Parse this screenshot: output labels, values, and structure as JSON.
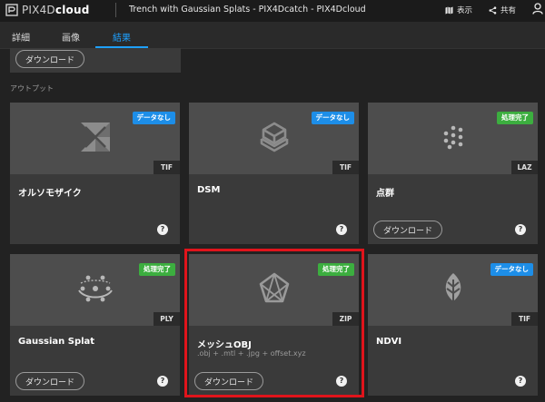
{
  "app": {
    "logo_prefix": "PIX4D",
    "logo_suffix": "cloud",
    "project_title": "Trench with Gaussian Splats - PIX4Dcatch - PIX4Dcloud",
    "view_label": "表示",
    "share_label": "共有"
  },
  "tabs": [
    {
      "label": "詳細",
      "active": false
    },
    {
      "label": "画像",
      "active": false
    },
    {
      "label": "結果",
      "active": true
    }
  ],
  "partial_card": {
    "download_label": "ダウンロード"
  },
  "section_label": "アウトプット",
  "colors": {
    "accent": "#1ea0ff",
    "badge_nodata": "#1d8ee8",
    "badge_done": "#3cae3f",
    "highlight": "#e0141b"
  },
  "cards": [
    {
      "title": "オルソモザイク",
      "subtitle": "",
      "badge": "データなし",
      "badge_type": "nodata",
      "format": "TIF",
      "icon": "orthomosaic-icon",
      "has_download": false,
      "help": "?"
    },
    {
      "title": "DSM",
      "subtitle": "",
      "badge": "データなし",
      "badge_type": "nodata",
      "format": "TIF",
      "icon": "dsm-icon",
      "has_download": false,
      "help": "?"
    },
    {
      "title": "点群",
      "subtitle": "",
      "badge": "処理完了",
      "badge_type": "done",
      "format": "LAZ",
      "icon": "point-cloud-icon",
      "has_download": true,
      "download_label": "ダウンロード",
      "help": "?"
    },
    {
      "title": "Gaussian Splat",
      "subtitle": "",
      "badge": "処理完了",
      "badge_type": "done",
      "format": "PLY",
      "icon": "gaussian-splat-icon",
      "has_download": true,
      "download_label": "ダウンロード",
      "help": "?"
    },
    {
      "title": "メッシュOBJ",
      "subtitle": ".obj + .mtl + .jpg + offset.xyz",
      "badge": "処理完了",
      "badge_type": "done",
      "format": "ZIP",
      "icon": "mesh-icon",
      "has_download": true,
      "download_label": "ダウンロード",
      "help": "?",
      "highlighted": true
    },
    {
      "title": "NDVI",
      "subtitle": "",
      "badge": "データなし",
      "badge_type": "nodata",
      "format": "TIF",
      "icon": "ndvi-leaf-icon",
      "has_download": false,
      "help": "?"
    }
  ]
}
